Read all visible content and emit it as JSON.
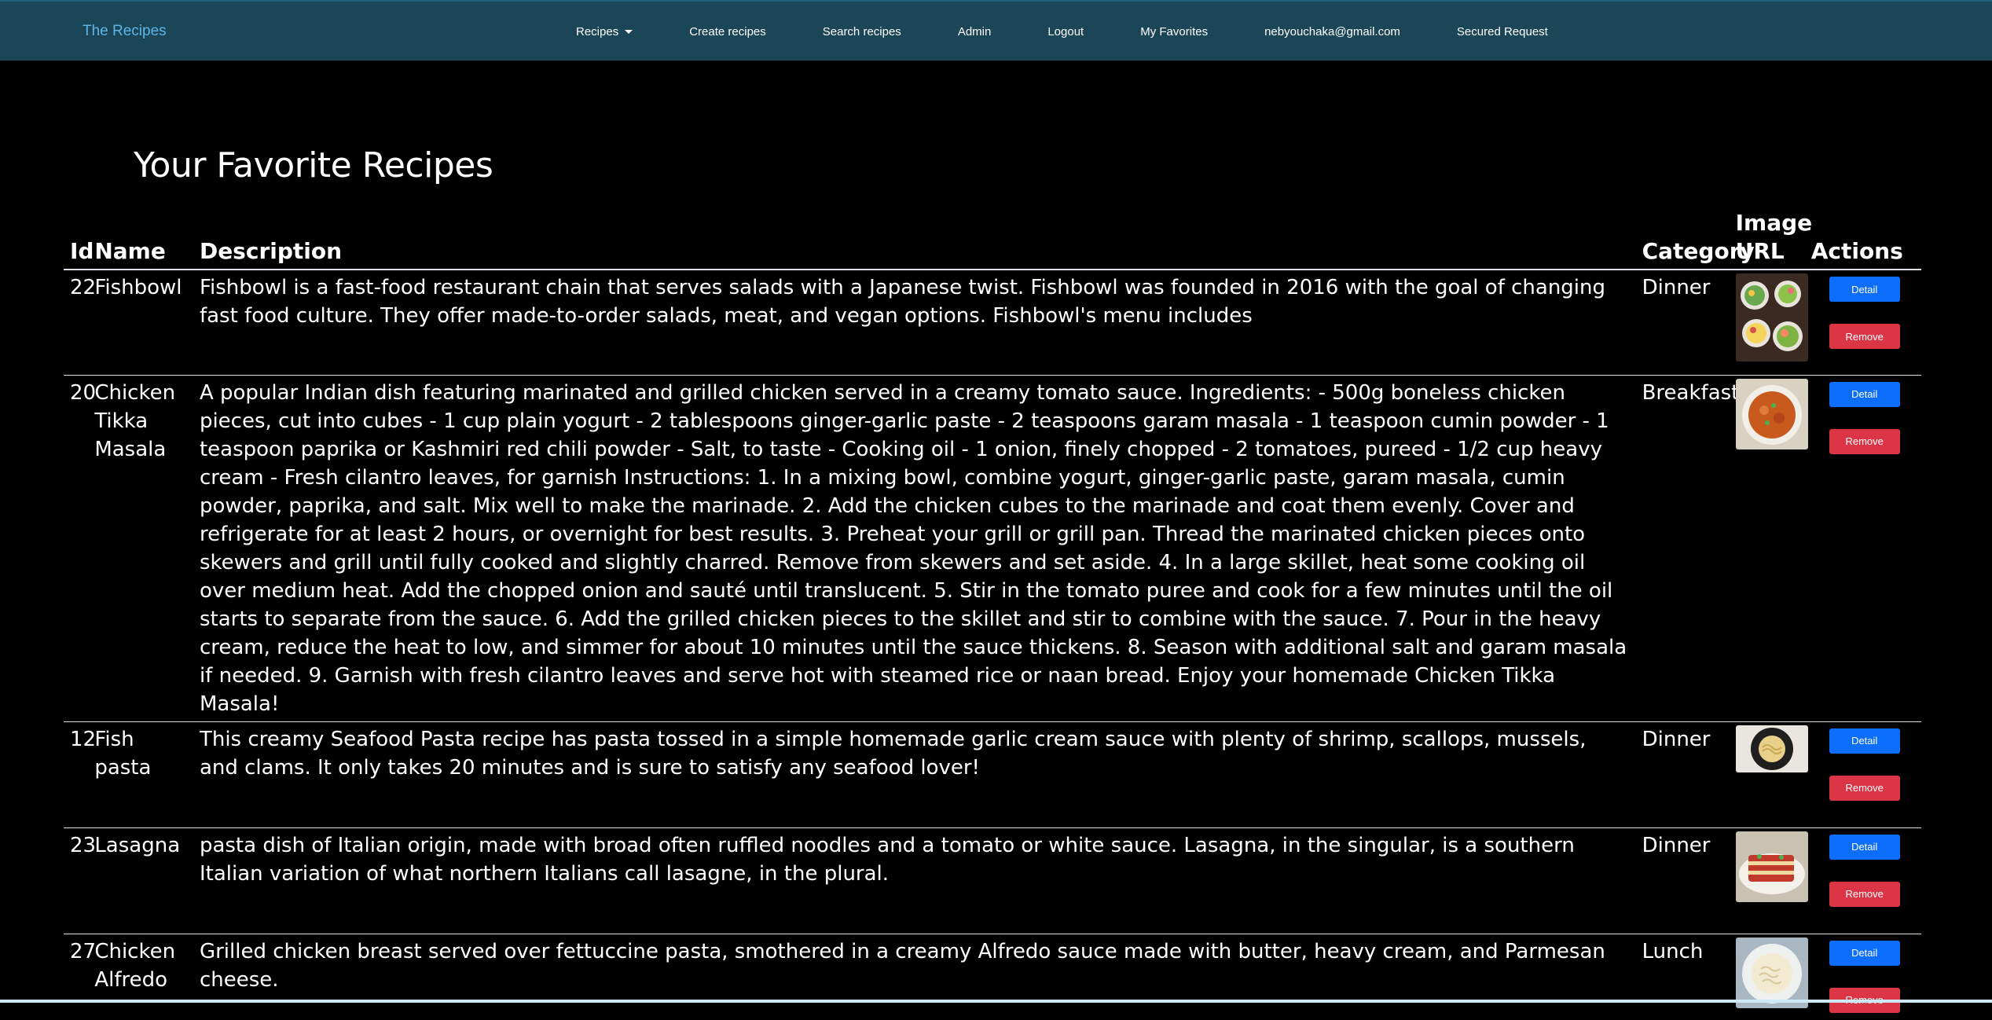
{
  "navbar": {
    "brand": "The Recipes",
    "links": {
      "recipes": "Recipes",
      "create": "Create recipes",
      "search": "Search recipes",
      "admin": "Admin",
      "logout": "Logout",
      "favorites": "My Favorites",
      "user": "nebyouchaka@gmail.com",
      "secured": "Secured Request"
    }
  },
  "main": {
    "title": "Your Favorite Recipes",
    "table": {
      "headers": {
        "id": "Id",
        "name": "Name",
        "description": "Description",
        "category": "Category",
        "image_url": "Image URL",
        "actions": "Actions"
      },
      "detail_label": "Detail",
      "remove_label": "Remove",
      "rows": [
        {
          "id": "22",
          "name": "Fishbowl",
          "description": "Fishbowl is a fast-food restaurant chain that serves salads with a Japanese twist. Fishbowl was founded in 2016 with the goal of changing fast food culture. They offer made-to-order salads, meat, and vegan options. Fishbowl's menu includes",
          "category": "Dinner"
        },
        {
          "id": "20",
          "name": "Chicken Tikka Masala",
          "description": "A popular Indian dish featuring marinated and grilled chicken served in a creamy tomato sauce. Ingredients: - 500g boneless chicken pieces, cut into cubes - 1 cup plain yogurt - 2 tablespoons ginger-garlic paste - 2 teaspoons garam masala - 1 teaspoon cumin powder - 1 teaspoon paprika or Kashmiri red chili powder - Salt, to taste - Cooking oil - 1 onion, finely chopped - 2 tomatoes, pureed - 1/2 cup heavy cream - Fresh cilantro leaves, for garnish Instructions: 1. In a mixing bowl, combine yogurt, ginger-garlic paste, garam masala, cumin powder, paprika, and salt. Mix well to make the marinade. 2. Add the chicken cubes to the marinade and coat them evenly. Cover and refrigerate for at least 2 hours, or overnight for best results. 3. Preheat your grill or grill pan. Thread the marinated chicken pieces onto skewers and grill until fully cooked and slightly charred. Remove from skewers and set aside. 4. In a large skillet, heat some cooking oil over medium heat. Add the chopped onion and sauté until translucent. 5. Stir in the tomato puree and cook for a few minutes until the oil starts to separate from the sauce. 6. Add the grilled chicken pieces to the skillet and stir to combine with the sauce. 7. Pour in the heavy cream, reduce the heat to low, and simmer for about 10 minutes until the sauce thickens. 8. Season with additional salt and garam masala if needed. 9. Garnish with fresh cilantro leaves and serve hot with steamed rice or naan bread. Enjoy your homemade Chicken Tikka Masala!",
          "category": "Breakfast"
        },
        {
          "id": "12",
          "name": "Fish pasta",
          "description": "This creamy Seafood Pasta recipe has pasta tossed in a simple homemade garlic cream sauce with plenty of shrimp, scallops, mussels, and clams. It only takes 20 minutes and is sure to satisfy any seafood lover!",
          "category": "Dinner"
        },
        {
          "id": "23",
          "name": "Lasagna",
          "description": "pasta dish of Italian origin, made with broad often ruffled noodles and a tomato or white sauce. Lasagna, in the singular, is a southern Italian variation of what northern Italians call lasagne, in the plural.",
          "category": "Dinner"
        },
        {
          "id": "27",
          "name": "Chicken Alfredo",
          "description": "Grilled chicken breast served over fettuccine pasta, smothered in a creamy Alfredo sauce made with butter, heavy cream, and Parmesan cheese.",
          "category": "Lunch"
        }
      ]
    }
  }
}
